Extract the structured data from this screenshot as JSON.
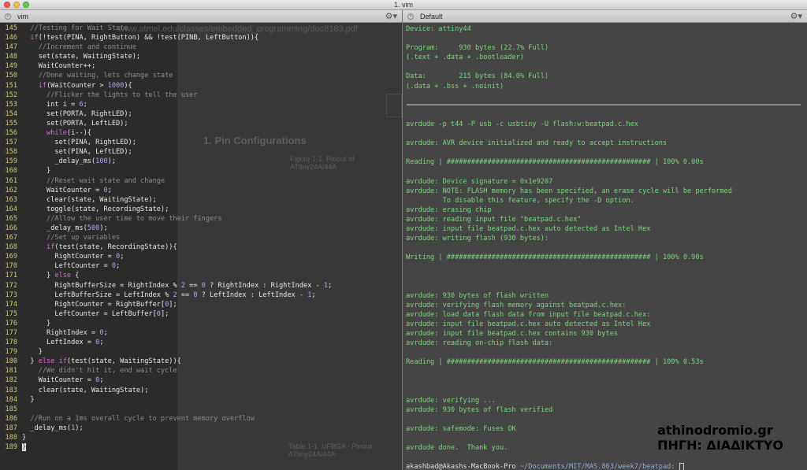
{
  "window": {
    "title": "1. vim"
  },
  "tabs": {
    "left": {
      "label": "vim"
    },
    "right": {
      "label": "Default"
    }
  },
  "background_pdf": {
    "url": "www.atmel.edu/classes/embedded_programming/doc8183.pdf",
    "heading": "1.   Pin Configurations",
    "figure": "Figure 1-1.    Pinout of ATtiny24A/44A",
    "table": "Table 1-1.     UFBGA - Pinout ATtiny24A/44A"
  },
  "vim_lines": [
    {
      "n": "145",
      "html": "  <span class='cm'>//Testing for Wait State</span>"
    },
    {
      "n": "146",
      "html": "  <span class='kw'>if</span>(!test(PINA, RightButton) &amp;&amp; !test(PINB, LeftButton)){"
    },
    {
      "n": "147",
      "html": "    <span class='cm'>//Increment and continue</span>"
    },
    {
      "n": "148",
      "html": "    set(state, WaitingState);"
    },
    {
      "n": "149",
      "html": "    WaitCounter++;"
    },
    {
      "n": "150",
      "html": "    <span class='cm'>//Done waiting, lets change state</span>"
    },
    {
      "n": "151",
      "html": "    <span class='kw'>if</span>(WaitCounter &gt; <span class='num'>1000</span>){"
    },
    {
      "n": "152",
      "html": "      <span class='cm'>//Flicker the lights to tell the user</span>"
    },
    {
      "n": "153",
      "html": "      int i = <span class='num'>6</span>;"
    },
    {
      "n": "154",
      "html": "      set(PORTA, RightLED);"
    },
    {
      "n": "155",
      "html": "      set(PORTA, LeftLED);"
    },
    {
      "n": "156",
      "html": "      <span class='kw'>while</span>(i--){"
    },
    {
      "n": "157",
      "html": "        set(PINA, RightLED);"
    },
    {
      "n": "158",
      "html": "        set(PINA, LeftLED);"
    },
    {
      "n": "159",
      "html": "        _delay_ms(<span class='num'>100</span>);"
    },
    {
      "n": "160",
      "html": "      }"
    },
    {
      "n": "161",
      "html": "      <span class='cm'>//Reset wait state and change</span>"
    },
    {
      "n": "162",
      "html": "      WaitCounter = <span class='num'>0</span>;"
    },
    {
      "n": "163",
      "html": "      clear(state, WaitingState);"
    },
    {
      "n": "164",
      "html": "      toggle(state, RecordingState);"
    },
    {
      "n": "165",
      "html": "      <span class='cm'>//Allow the user time to move their fingers</span>"
    },
    {
      "n": "166",
      "html": "      _delay_ms(<span class='num'>500</span>);"
    },
    {
      "n": "167",
      "html": "      <span class='cm'>//Set up variables</span>"
    },
    {
      "n": "168",
      "html": "      <span class='kw'>if</span>(test(state, RecordingState)){"
    },
    {
      "n": "169",
      "html": "        RightCounter = <span class='num'>0</span>;"
    },
    {
      "n": "170",
      "html": "        LeftCounter = <span class='num'>0</span>;"
    },
    {
      "n": "171",
      "html": "      } <span class='kw'>else</span> {"
    },
    {
      "n": "172",
      "html": "        RightBufferSize = RightIndex % <span class='num'>2</span> == <span class='num'>0</span> ? RightIndex : RightIndex - <span class='num'>1</span>;"
    },
    {
      "n": "173",
      "html": "        LeftBufferSize = LeftIndex % <span class='num'>2</span> == <span class='num'>0</span> ? LeftIndex : LeftIndex - <span class='num'>1</span>;"
    },
    {
      "n": "174",
      "html": "        RightCounter = RightBuffer[<span class='num'>0</span>];"
    },
    {
      "n": "175",
      "html": "        LeftCounter = LeftBuffer[<span class='num'>0</span>];"
    },
    {
      "n": "176",
      "html": "      }"
    },
    {
      "n": "177",
      "html": "      RightIndex = <span class='num'>0</span>;"
    },
    {
      "n": "178",
      "html": "      LeftIndex = <span class='num'>0</span>;"
    },
    {
      "n": "179",
      "html": "    }"
    },
    {
      "n": "180",
      "html": "  } <span class='kw'>else if</span>(test(state, WaitingState)){"
    },
    {
      "n": "181",
      "html": "    <span class='cm'>//We didn't hit it, end wait cycle</span>"
    },
    {
      "n": "182",
      "html": "    WaitCounter = <span class='num'>0</span>;"
    },
    {
      "n": "183",
      "html": "    clear(state, WaitingState);"
    },
    {
      "n": "184",
      "html": "  }"
    },
    {
      "n": "185",
      "html": ""
    },
    {
      "n": "186",
      "html": "  <span class='cm'>//Run on a 1ms overall cycle to prevent memory overflow</span>"
    },
    {
      "n": "187",
      "html": "  _delay_ms(<span class='num'>1</span>);"
    },
    {
      "n": "188",
      "html": "}"
    },
    {
      "n": "189",
      "html": "<span class='cursor'>}</span>"
    }
  ],
  "terminal_lines": [
    "Device: attiny44",
    "",
    "Program:     930 bytes (22.7% Full)",
    "(.text + .data + .bootloader)",
    "",
    "Data:        215 bytes (84.0% Full)",
    "(.data + .bss + .noinit)",
    "",
    "",
    "",
    "avrdude -p t44 -P usb -c usbtiny -U flash:w:beatpad.c.hex",
    "",
    "avrdude: AVR device initialized and ready to accept instructions",
    "",
    "Reading | ################################################## | 100% 0.00s",
    "",
    "avrdude: Device signature = 0x1e9207",
    "avrdude: NOTE: FLASH memory has been specified, an erase cycle will be performed",
    "         To disable this feature, specify the -D option.",
    "avrdude: erasing chip",
    "avrdude: reading input file \"beatpad.c.hex\"",
    "avrdude: input file beatpad.c.hex auto detected as Intel Hex",
    "avrdude: writing flash (930 bytes):",
    "",
    "Writing | ################################################## | 100% 0.90s",
    "",
    "",
    "",
    "avrdude: 930 bytes of flash written",
    "avrdude: verifying flash memory against beatpad.c.hex:",
    "avrdude: load data flash data from input file beatpad.c.hex:",
    "avrdude: input file beatpad.c.hex auto detected as Intel Hex",
    "avrdude: input file beatpad.c.hex contains 930 bytes",
    "avrdude: reading on-chip flash data:",
    "",
    "Reading | ################################################## | 100% 0.53s",
    "",
    "",
    "",
    "avrdude: verifying ...",
    "avrdude: 930 bytes of flash verified",
    "",
    "avrdude: safemode: Fuses OK",
    "",
    "avrdude done.  Thank you.",
    ""
  ],
  "prompt": {
    "user": "akashbad@Akashs-MacBook-Pro",
    "path": "~/Documents/MIT/MAS.863/week7/beatpad:"
  },
  "watermark": {
    "line1": "athinodromio.gr",
    "line2": "ΠΗΓΗ: ΔΙΑΔΙΚΤΥΟ"
  },
  "icons": [
    "close-icon",
    "minimize-icon",
    "maximize-icon",
    "gear-icon"
  ]
}
